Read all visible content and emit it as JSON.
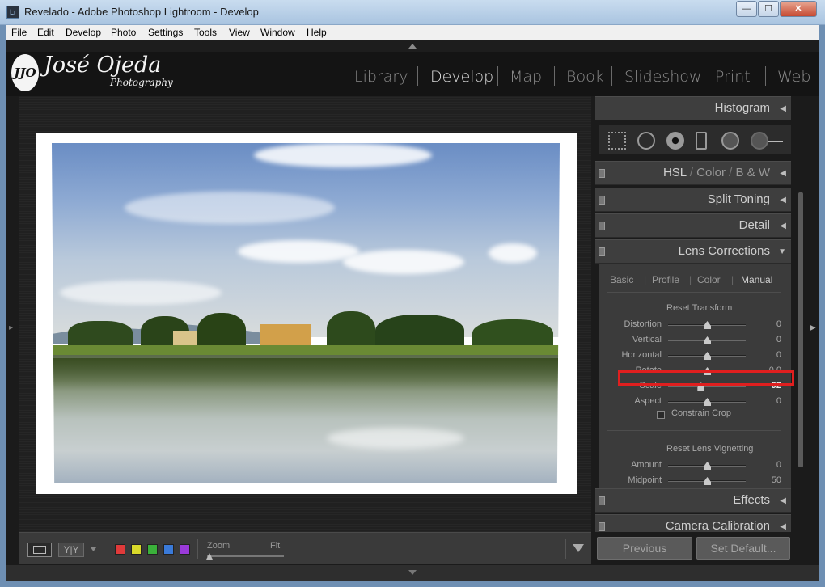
{
  "window": {
    "title": "Revelado - Adobe Photoshop Lightroom - Develop",
    "app_icon": "Lr",
    "minimize": "—",
    "maximize": "☐",
    "close": "✕"
  },
  "menu": [
    "File",
    "Edit",
    "Develop",
    "Photo",
    "Settings",
    "Tools",
    "View",
    "Window",
    "Help"
  ],
  "identity": {
    "logo_mark": "JJO",
    "name": "José Ojeda",
    "sub": "Photography"
  },
  "modules": [
    "Library",
    "Develop",
    "Map",
    "Book",
    "Slideshow",
    "Print",
    "Web"
  ],
  "active_module": "Develop",
  "toolbar": {
    "zoom_label": "Zoom",
    "fit_label": "Fit",
    "yy": "Y|Y",
    "swatch_colors": [
      "#e03a3a",
      "#d9d92a",
      "#3ab03a",
      "#3a7ad9",
      "#9a3ad9"
    ]
  },
  "panels": {
    "histogram": "Histogram",
    "hsl": {
      "a": "HSL",
      "sep1": "/",
      "b": "Color",
      "sep2": "/",
      "c": "B & W"
    },
    "split_toning": "Split Toning",
    "detail": "Detail",
    "lens_corrections": "Lens Corrections",
    "effects": "Effects",
    "camera_calibration": "Camera Calibration"
  },
  "lens": {
    "tabs": [
      "Basic",
      "Profile",
      "Color",
      "Manual"
    ],
    "active_tab": "Manual",
    "reset_transform": "Reset Transform",
    "sliders": [
      {
        "label": "Distortion",
        "value": "0",
        "pos": 0.5
      },
      {
        "label": "Vertical",
        "value": "0",
        "pos": 0.5
      },
      {
        "label": "Horizontal",
        "value": "0",
        "pos": 0.5
      },
      {
        "label": "Rotate",
        "value": "0.0",
        "pos": 0.5
      },
      {
        "label": "Scale",
        "value": "92",
        "pos": 0.42
      },
      {
        "label": "Aspect",
        "value": "0",
        "pos": 0.5
      }
    ],
    "constrain_crop": "Constrain Crop",
    "reset_vignetting": "Reset Lens Vignetting",
    "vignetting": [
      {
        "label": "Amount",
        "value": "0",
        "pos": 0.5
      },
      {
        "label": "Midpoint",
        "value": "50",
        "pos": 0.5
      }
    ]
  },
  "buttons": {
    "previous": "Previous",
    "set_default": "Set Default..."
  }
}
